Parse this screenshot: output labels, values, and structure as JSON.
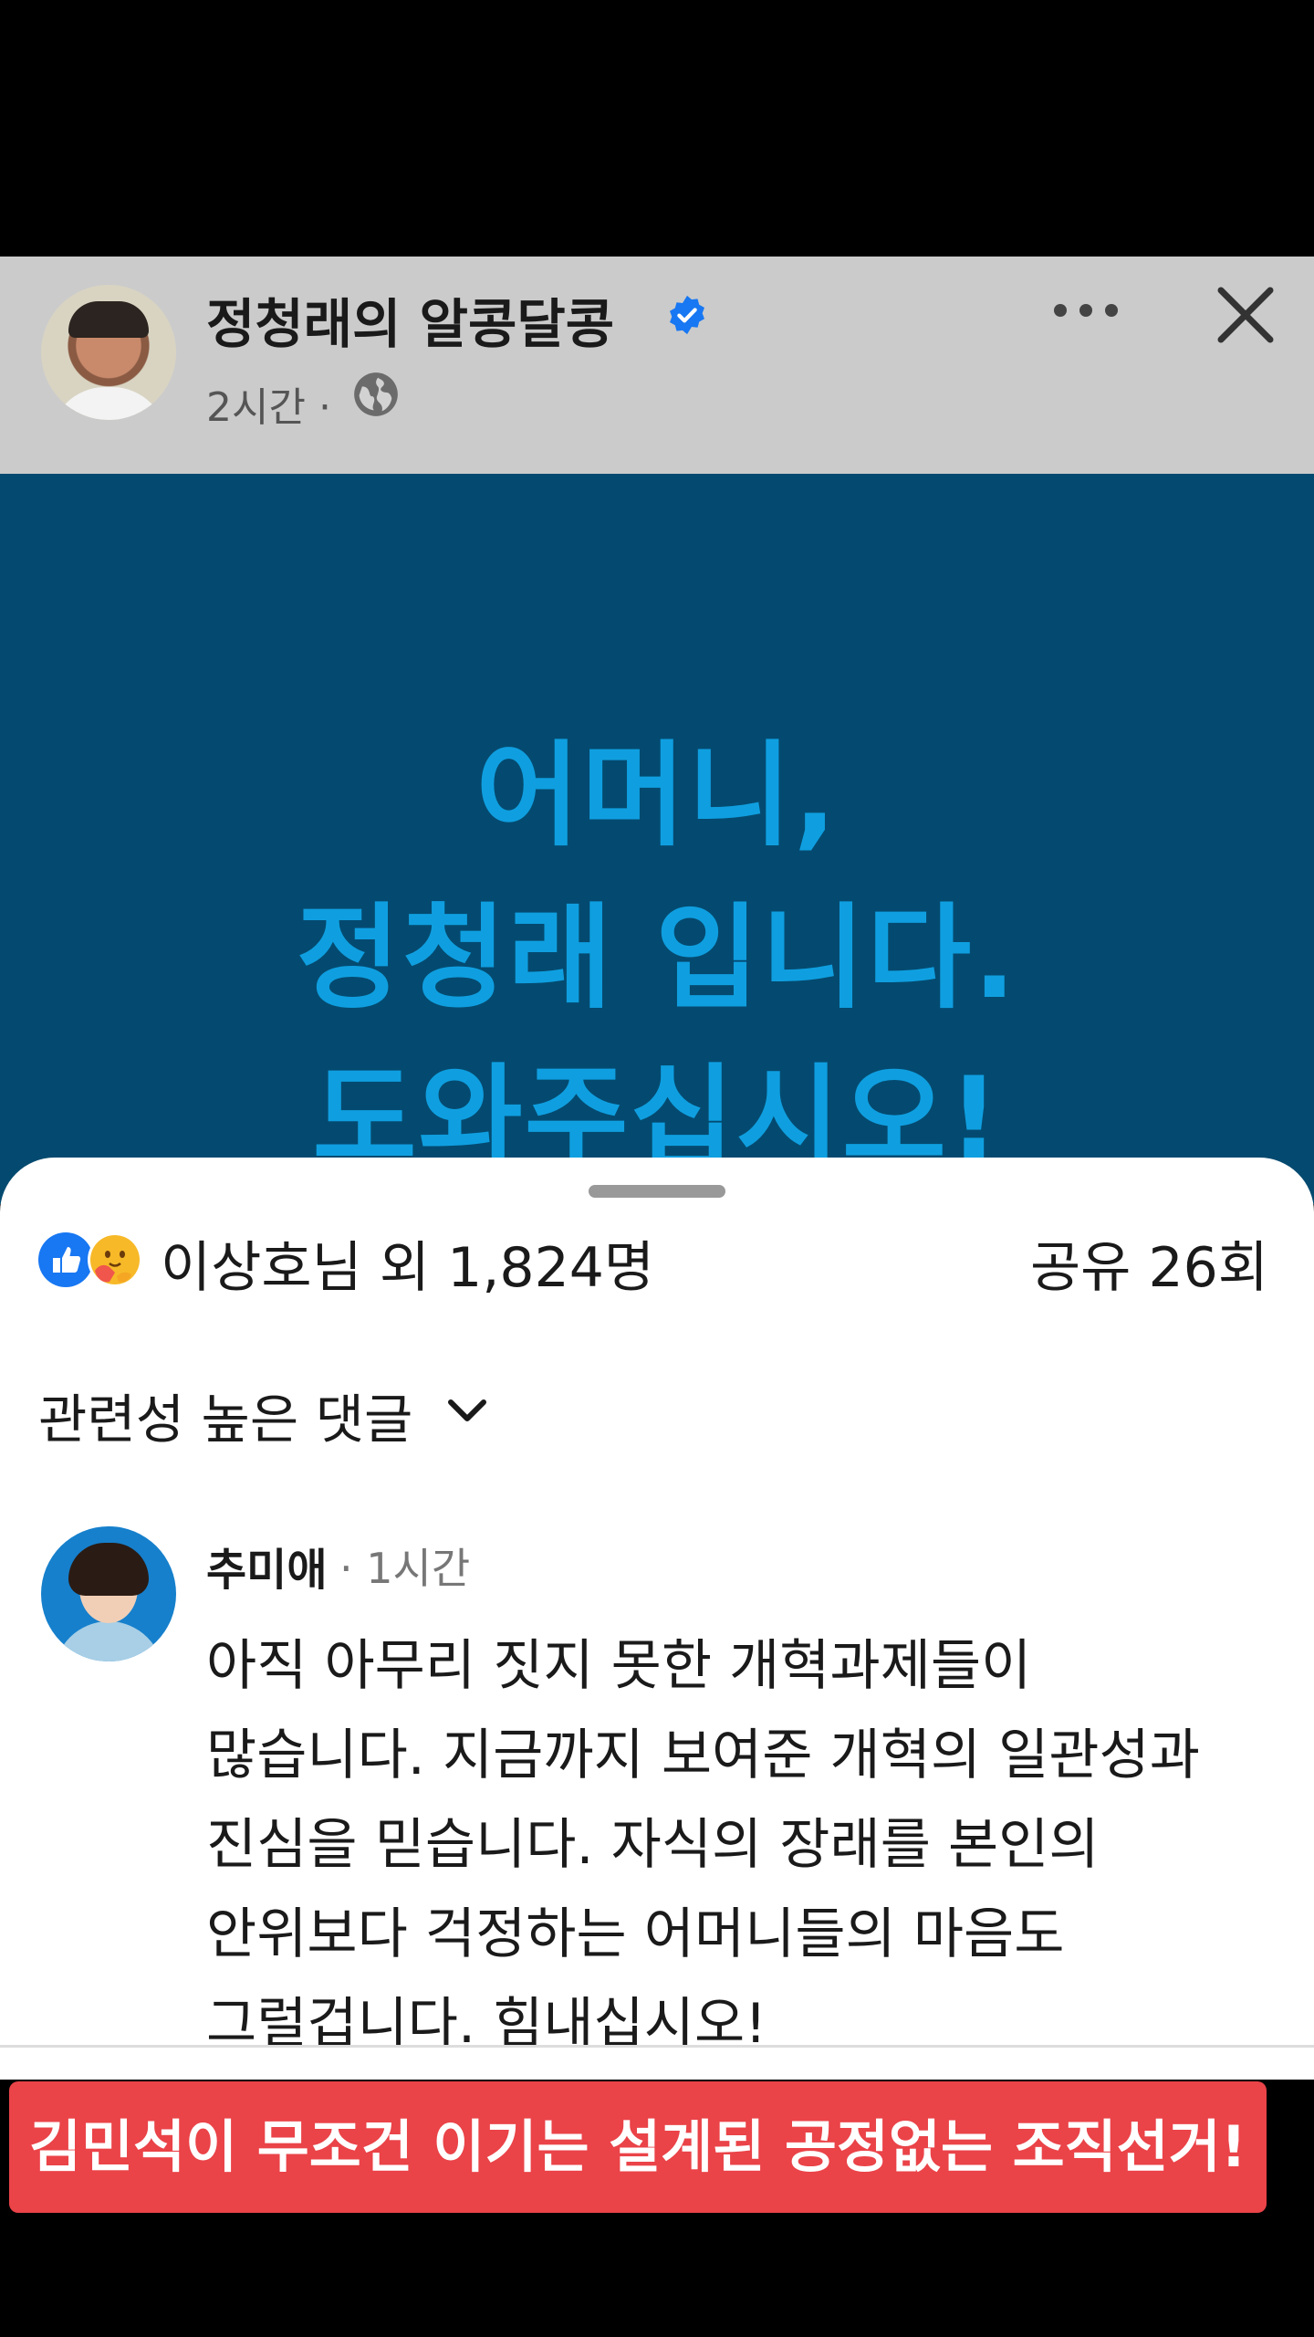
{
  "post": {
    "page_name": "정청래의 알콩달콩",
    "time": "2시간 ·",
    "verified_icon": "verified-badge-icon",
    "privacy_icon": "globe-icon"
  },
  "banner": {
    "line1": "어머니,",
    "line2": "정청래 입니다.",
    "line3": "도와주십시오!"
  },
  "engagement": {
    "reactions_text": "이상호님 외 1,824명",
    "shares_text": "공유 26회",
    "reaction_icons": [
      "like-icon",
      "care-icon"
    ]
  },
  "comments": {
    "sort_label": "관련성 높은 댓글",
    "items": [
      {
        "author": "추미애",
        "time": "· 1시간",
        "lines": [
          "아직 아무리 짓지 못한 개혁과제들이",
          "많습니다. 지금까지 보여준 개혁의 일관성과",
          "진심을 믿습니다. 자식의 장래를 본인의",
          "안위보다 걱정하는 어머니들의 마음도",
          "그럴겁니다. 힘내십시오!"
        ]
      }
    ]
  },
  "overlay": {
    "text": "김민석이 무조건 이기는 설계된 공정없는 조직선거!"
  },
  "colors": {
    "banner_bg": "#044a70",
    "banner_text": "#0f9fe0",
    "alert_bg": "#ea4348",
    "verified": "#1877f2"
  }
}
